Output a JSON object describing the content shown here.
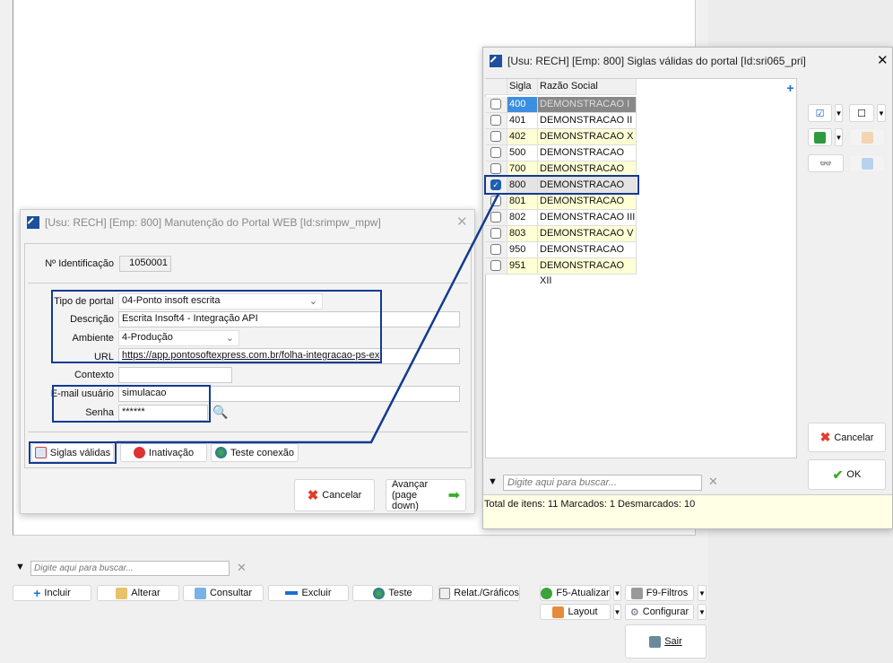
{
  "background": {
    "search_placeholder": "Digite aqui para buscar...",
    "buttons": {
      "incluir": "Incluir",
      "alterar": "Alterar",
      "consultar": "Consultar",
      "excluir": "Excluir",
      "teste": "Teste",
      "relat": "Relat./Gráficos",
      "atualizar": "F5-Atualizar",
      "filtros": "F9-Filtros",
      "layout": "Layout",
      "configurar": "Configurar",
      "sair": "Sair"
    }
  },
  "dialog1": {
    "title": "[Usu: RECH] [Emp: 800] Manutenção do Portal WEB [Id:srimpw_mpw]",
    "fields": {
      "id_label": "Nº Identificação",
      "id_value": "1050001",
      "tipo_label": "Tipo de portal",
      "tipo_value": "04-Ponto insoft escrita",
      "desc_label": "Descrição",
      "desc_value": "Escrita Insoft4 - Integração API",
      "amb_label": "Ambiente",
      "amb_value": "4-Produção",
      "url_label": "URL",
      "url_value": "https://app.pontosoftexpress.com.br/folha-integracao-ps-ex",
      "ctx_label": "Contexto",
      "ctx_value": "",
      "email_label": "E-mail usuário",
      "email_value": "simulacao",
      "senha_label": "Senha",
      "senha_value": "******"
    },
    "buttons": {
      "siglas": "Siglas válidas",
      "inativacao": "Inativação",
      "teste": "Teste conexão",
      "cancelar": "Cancelar",
      "avancar1": "Avançar",
      "avancar2": "(page down)"
    }
  },
  "dialog2": {
    "title": "[Usu: RECH] [Emp: 800] Siglas válidas do portal [Id:sri065_pri]",
    "columns": [
      "Sigla",
      "Razão Social"
    ],
    "rows": [
      {
        "sigla": "400",
        "razao": "DEMONSTRACAO I",
        "checked": false
      },
      {
        "sigla": "401",
        "razao": "DEMONSTRACAO II",
        "checked": false
      },
      {
        "sigla": "402",
        "razao": "DEMONSTRACAO X",
        "checked": false
      },
      {
        "sigla": "500",
        "razao": "DEMONSTRACAO IX",
        "checked": false
      },
      {
        "sigla": "700",
        "razao": "DEMONSTRACAO VII",
        "checked": false
      },
      {
        "sigla": "800",
        "razao": "DEMONSTRACAO",
        "checked": true
      },
      {
        "sigla": "801",
        "razao": "DEMONSTRACAO IV",
        "checked": false
      },
      {
        "sigla": "802",
        "razao": "DEMONSTRACAO III",
        "checked": false
      },
      {
        "sigla": "803",
        "razao": "DEMONSTRACAO V",
        "checked": false
      },
      {
        "sigla": "950",
        "razao": "DEMONSTRACAO VIII",
        "checked": false
      },
      {
        "sigla": "951",
        "razao": "DEMONSTRACAO XII",
        "checked": false
      }
    ],
    "search_placeholder": "Digite aqui para buscar...",
    "cancelar": "Cancelar",
    "ok": "OK",
    "status": "Total de itens: 11 Marcados: 1 Desmarcados: 10"
  },
  "colors": {
    "highlight": "#123a8f",
    "row_yellow": "#ffffd6",
    "selected_cell": "#3c8fe0"
  }
}
